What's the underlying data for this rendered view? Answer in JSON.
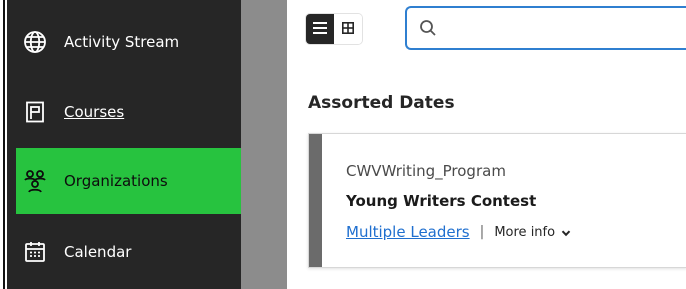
{
  "sidebar": {
    "items": [
      {
        "label": "Activity Stream",
        "icon": "globe-icon"
      },
      {
        "label": "Courses",
        "icon": "courses-icon"
      },
      {
        "label": "Organizations",
        "icon": "organizations-icon"
      },
      {
        "label": "Calendar",
        "icon": "calendar-icon"
      }
    ],
    "active_item": "Organizations",
    "colors": {
      "background": "#262626",
      "active": "#27c33f"
    }
  },
  "toolbar": {
    "view_toggle": {
      "list_icon": "list-view-icon",
      "grid_icon": "grid-view-icon",
      "selected": "list"
    },
    "search": {
      "placeholder": "",
      "value": "",
      "icon": "search-icon"
    }
  },
  "main": {
    "section_title": "Assorted Dates",
    "card": {
      "course": "CWVWriting_Program",
      "title": "Young Writers Contest",
      "leaders_link": "Multiple Leaders",
      "separator": "|",
      "more_info": "More info"
    }
  },
  "colors": {
    "accent_blue": "#2f7fd0",
    "link": "#1f6fcf",
    "divider": "#8c8c8c"
  }
}
